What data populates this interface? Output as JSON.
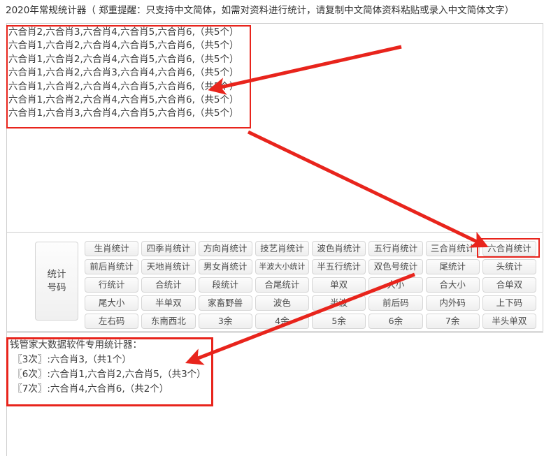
{
  "header": {
    "year": "2020年",
    "rest": "常规统计器（ 郑重提醒：只支持中文简体，如需对资料进行统计，请复制中文简体资料粘贴或录入中文简体文字）",
    "year_color": "#e8302a"
  },
  "input": {
    "lines": [
      "六合肖2,六合肖3,六合肖4,六合肖5,六合肖6,（共5个）",
      "六合肖1,六合肖2,六合肖4,六合肖5,六合肖6,（共5个）",
      "六合肖1,六合肖2,六合肖4,六合肖5,六合肖6,（共5个）",
      "六合肖1,六合肖2,六合肖3,六合肖4,六合肖6,（共5个）",
      "六合肖1,六合肖2,六合肖4,六合肖5,六合肖6,（共5个）",
      "六合肖1,六合肖2,六合肖4,六合肖5,六合肖6,（共5个）",
      "六合肖1,六合肖3,六合肖4,六合肖5,六合肖6,（共5个）"
    ],
    "text": "六合肖2,六合肖3,六合肖4,六合肖5,六合肖6,（共5个）\n六合肖1,六合肖2,六合肖4,六合肖5,六合肖6,（共5个）\n六合肖1,六合肖2,六合肖4,六合肖5,六合肖6,（共5个）\n六合肖1,六合肖2,六合肖3,六合肖4,六合肖6,（共5个）\n六合肖1,六合肖2,六合肖4,六合肖5,六合肖6,（共5个）\n六合肖1,六合肖2,六合肖4,六合肖5,六合肖6,（共5个）\n六合肖1,六合肖3,六合肖4,六合肖5,六合肖6,（共5个）"
  },
  "panel": {
    "main_button_line1": "统计",
    "main_button_line2": "号码",
    "selected_button": "六合肖统计",
    "rows": [
      [
        "生肖统计",
        "四季肖统计",
        "方向肖统计",
        "技艺肖统计",
        "波色肖统计",
        "五行肖统计",
        "三合肖统计",
        "六合肖统计"
      ],
      [
        "前后肖统计",
        "天地肖统计",
        "男女肖统计",
        "半波大小统计",
        "半五行统计",
        "双色号统计",
        "尾统计",
        "头统计"
      ],
      [
        "行统计",
        "合统计",
        "段统计",
        "合尾统计",
        "单双",
        "大小",
        "合大小",
        "合单双"
      ],
      [
        "尾大小",
        "半单双",
        "家畜野兽",
        "波色",
        "半波",
        "前后码",
        "内外码",
        "上下码"
      ],
      [
        "左右码",
        "东南西北",
        "3余",
        "4余",
        "5余",
        "6余",
        "7余",
        "半头单双"
      ]
    ]
  },
  "result": {
    "title": "钱管家大数据软件专用统计器：",
    "lines": [
      "〖3次〗:六合肖3,（共1个）",
      "〖6次〗:六合肖1,六合肖2,六合肖5,（共3个）",
      "〖7次〗:六合肖4,六合肖6,（共2个）"
    ],
    "text": "钱管家大数据软件专用统计器：\n 〖3次〗:六合肖3,（共1个）\n 〖6次〗:六合肖1,六合肖2,六合肖5,（共3个）\n 〖7次〗:六合肖4,六合肖6,（共2个）"
  },
  "annotations": {
    "accent_color": "#e8241c",
    "arrow_count": 3
  }
}
